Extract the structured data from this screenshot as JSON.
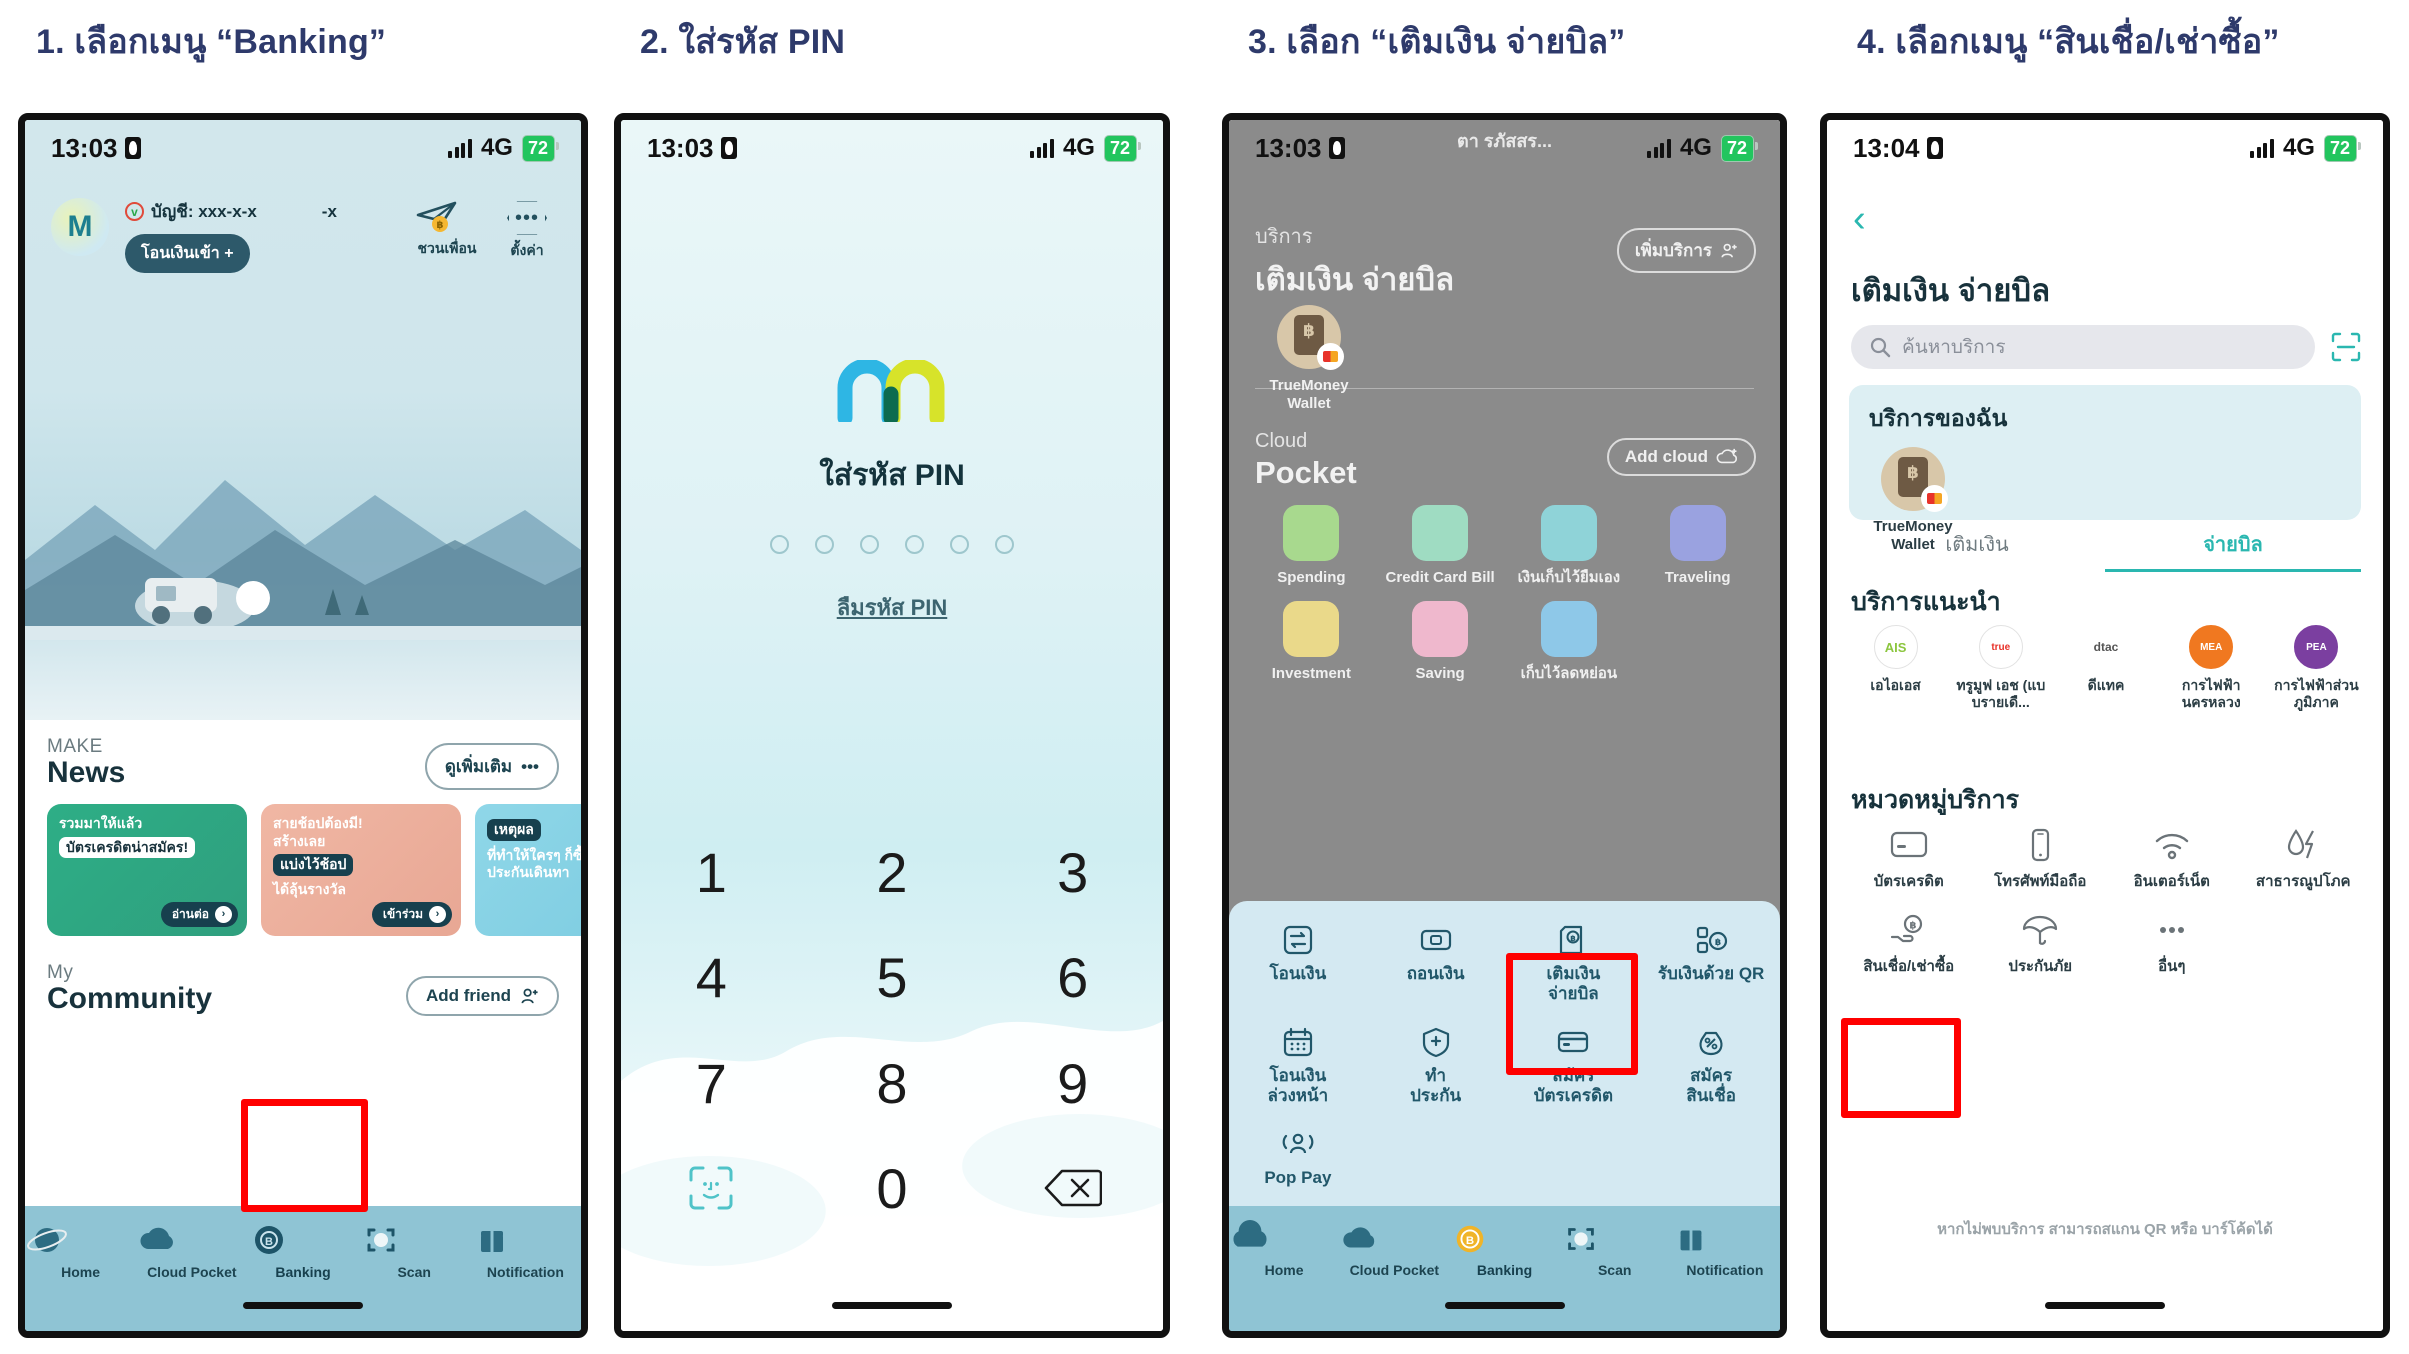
{
  "captions": [
    "1. เลือกเมนู “Banking”",
    "2. ใส่รหัส PIN",
    "3. เลือก “เติมเงิน จ่ายบิล”",
    "4. เลือกเมนู “สินเชื่อ/เช่าซื้อ”"
  ],
  "colors": {
    "caption": "#2e3a6b",
    "highlight": "#ff0000",
    "accent_teal": "#2ab7b0",
    "tabbar": "#8fc4d4",
    "sheet": "#d4e9f2"
  },
  "panel1": {
    "status": {
      "time": "13:03",
      "network": "4G",
      "battery": "72"
    },
    "account": {
      "avatar_letter": "M",
      "label": "บัญชี: xxx-x-x",
      "masked_tail": "-x",
      "transfer_in_button": "โอนเงินเข้า +"
    },
    "header_actions": [
      {
        "label": "ชวนเพื่อน",
        "icon": "paper-plane-coin-icon"
      },
      {
        "label": "ตั้งค่า",
        "icon": "settings-hex-dots-icon"
      }
    ],
    "news": {
      "kicker": "MAKE",
      "title": "News",
      "more_button": "ดูเพิ่มเติม",
      "cards": [
        {
          "line1": "รวมมาให้แล้ว",
          "line2": "บัตรเครดิตน่าสมัคร!",
          "cta": "อ่านต่อ"
        },
        {
          "line1": "สายช้อปต้องมี!",
          "line2": "สร้างเลย",
          "chip": "แบ่งไว้ช้อป",
          "line3": "ได้ลุ้นรางวัล",
          "cta": "เข้าร่วม"
        },
        {
          "chip": "เหตุผล",
          "line2": "ที่ทำให้ใครๆ ก็ซื้",
          "line3": "ประกันเดินทา",
          "cta": ""
        }
      ]
    },
    "community": {
      "kicker": "My",
      "title": "Community",
      "add_friend_button": "Add friend"
    },
    "tabs": [
      {
        "label": "Home",
        "icon": "planet-icon",
        "active": false
      },
      {
        "label": "Cloud Pocket",
        "icon": "cloud-icon",
        "active": false
      },
      {
        "label": "Banking",
        "icon": "baht-coin-icon",
        "active": true
      },
      {
        "label": "Scan",
        "icon": "scan-icon",
        "active": false
      },
      {
        "label": "Notification",
        "icon": "gift-icon",
        "active": false
      }
    ],
    "highlight_tab": "Banking"
  },
  "panel2": {
    "status": {
      "time": "13:03",
      "network": "4G",
      "battery": "72"
    },
    "logo": "make-m-logo",
    "title": "ใส่รหัส PIN",
    "pin_length": 6,
    "forgot_pin": "ลืมรหัส PIN",
    "keys": [
      "1",
      "2",
      "3",
      "4",
      "5",
      "6",
      "7",
      "8",
      "9",
      "face-id-icon",
      "0",
      "backspace-icon"
    ]
  },
  "panel3": {
    "toast": "ตา รภัสสร...",
    "status": {
      "time": "13:03",
      "network": "4G",
      "battery": "72"
    },
    "services": {
      "kicker": "บริการ",
      "title": "เติมเงิน จ่ายบิล",
      "add_button": "เพิ่มบริการ",
      "items": [
        {
          "label1": "TrueMoney",
          "label2": "Wallet",
          "icon": "truemoney-wallet-icon"
        }
      ]
    },
    "cloud_pocket": {
      "kicker": "Cloud",
      "title": "Pocket",
      "add_button": "Add cloud",
      "items": [
        {
          "label": "Spending",
          "color": "#a8d98e"
        },
        {
          "label": "Credit Card Bill",
          "color": "#9fdcc2"
        },
        {
          "label": "เงินเก็บไว้ยืมเอง",
          "color": "#8fd3d8"
        },
        {
          "label": "Traveling",
          "color": "#9aa2e0"
        },
        {
          "label": "Investment",
          "color": "#ead98a"
        },
        {
          "label": "Saving",
          "color": "#efb8cd"
        },
        {
          "label": "เก็บไว้ลดหย่อน",
          "color": "#8ec8e8"
        }
      ]
    },
    "sheet_menu": [
      {
        "label1": "โอนเงิน",
        "label2": "",
        "icon": "transfer-icon"
      },
      {
        "label1": "ถอนเงิน",
        "label2": "",
        "icon": "withdraw-icon"
      },
      {
        "label1": "เติมเงิน",
        "label2": "จ่ายบิล",
        "icon": "topup-bill-icon"
      },
      {
        "label1": "รับเงินด้วย QR",
        "label2": "",
        "icon": "qr-receive-icon"
      },
      {
        "label1": "โอนเงิน",
        "label2": "ล่วงหน้า",
        "icon": "calendar-icon"
      },
      {
        "label1": "ทำ",
        "label2": "ประกัน",
        "icon": "shield-plus-icon"
      },
      {
        "label1": "สมัคร",
        "label2": "บัตรเครดิต",
        "icon": "credit-card-icon"
      },
      {
        "label1": "สมัคร",
        "label2": "สินเชื่อ",
        "icon": "loan-bag-icon"
      },
      {
        "label1": "Pop Pay",
        "label2": "",
        "icon": "pop-pay-icon"
      }
    ],
    "highlight_item": "เติมเงิน จ่ายบิล",
    "tabs": [
      {
        "label": "Home",
        "icon": "home-icon",
        "active": false
      },
      {
        "label": "Cloud Pocket",
        "icon": "cloud-icon",
        "active": false
      },
      {
        "label": "Banking",
        "icon": "baht-coin-icon",
        "active": true
      },
      {
        "label": "Scan",
        "icon": "scan-icon",
        "active": false
      },
      {
        "label": "Notification",
        "icon": "gift-icon",
        "active": false
      }
    ]
  },
  "panel4": {
    "status": {
      "time": "13:04",
      "network": "4G",
      "battery": "72"
    },
    "back": "back-chevron-icon",
    "title": "เติมเงิน จ่ายบิล",
    "search": {
      "placeholder": "ค้นหาบริการ",
      "value": "",
      "scan_icon": "scan-qr-icon"
    },
    "my_services": {
      "title": "บริการของฉัน",
      "items": [
        {
          "label1": "TrueMoney",
          "label2": "Wallet",
          "icon": "truemoney-wallet-icon"
        }
      ]
    },
    "tabs": [
      {
        "label": "เติมเงิน",
        "selected": false
      },
      {
        "label": "จ่ายบิล",
        "selected": true
      }
    ],
    "recommended": {
      "title": "บริการแนะนำ",
      "items": [
        {
          "label": "เอไอเอส",
          "logo": "AIS",
          "color": "#8cc63f"
        },
        {
          "label": "ทรูมูฟ เอช (แบบรายเดื...",
          "logo": "true",
          "color": "#e8322a"
        },
        {
          "label": "ดีแทค",
          "logo": "dtac",
          "color": "#555555"
        },
        {
          "label": "การไฟฟ้านครหลวง",
          "logo": "MEA",
          "color": "#f07820"
        },
        {
          "label": "การไฟฟ้าส่วนภูมิภาค",
          "logo": "PEA",
          "color": "#7b3fa0"
        }
      ]
    },
    "categories": {
      "title": "หมวดหมู่บริการ",
      "items": [
        {
          "label": "บัตรเครดิต",
          "icon": "credit-card-icon"
        },
        {
          "label": "โทรศัพท์มือถือ",
          "icon": "mobile-phone-icon"
        },
        {
          "label": "อินเตอร์เน็ต",
          "icon": "wifi-icon"
        },
        {
          "label": "สาธารณูปโภค",
          "icon": "water-electric-icon"
        },
        {
          "label": "สินเชื่อ/เช่าซื้อ",
          "icon": "loan-hand-baht-icon"
        },
        {
          "label": "ประกันภัย",
          "icon": "umbrella-icon"
        },
        {
          "label": "อื่นๆ",
          "icon": "ellipsis-icon"
        }
      ]
    },
    "highlight_item": "สินเชื่อ/เช่าซื้อ",
    "footer_note": "หากไม่พบบริการ สามารถสแกน QR หรือ บาร์โค้ดได้"
  }
}
